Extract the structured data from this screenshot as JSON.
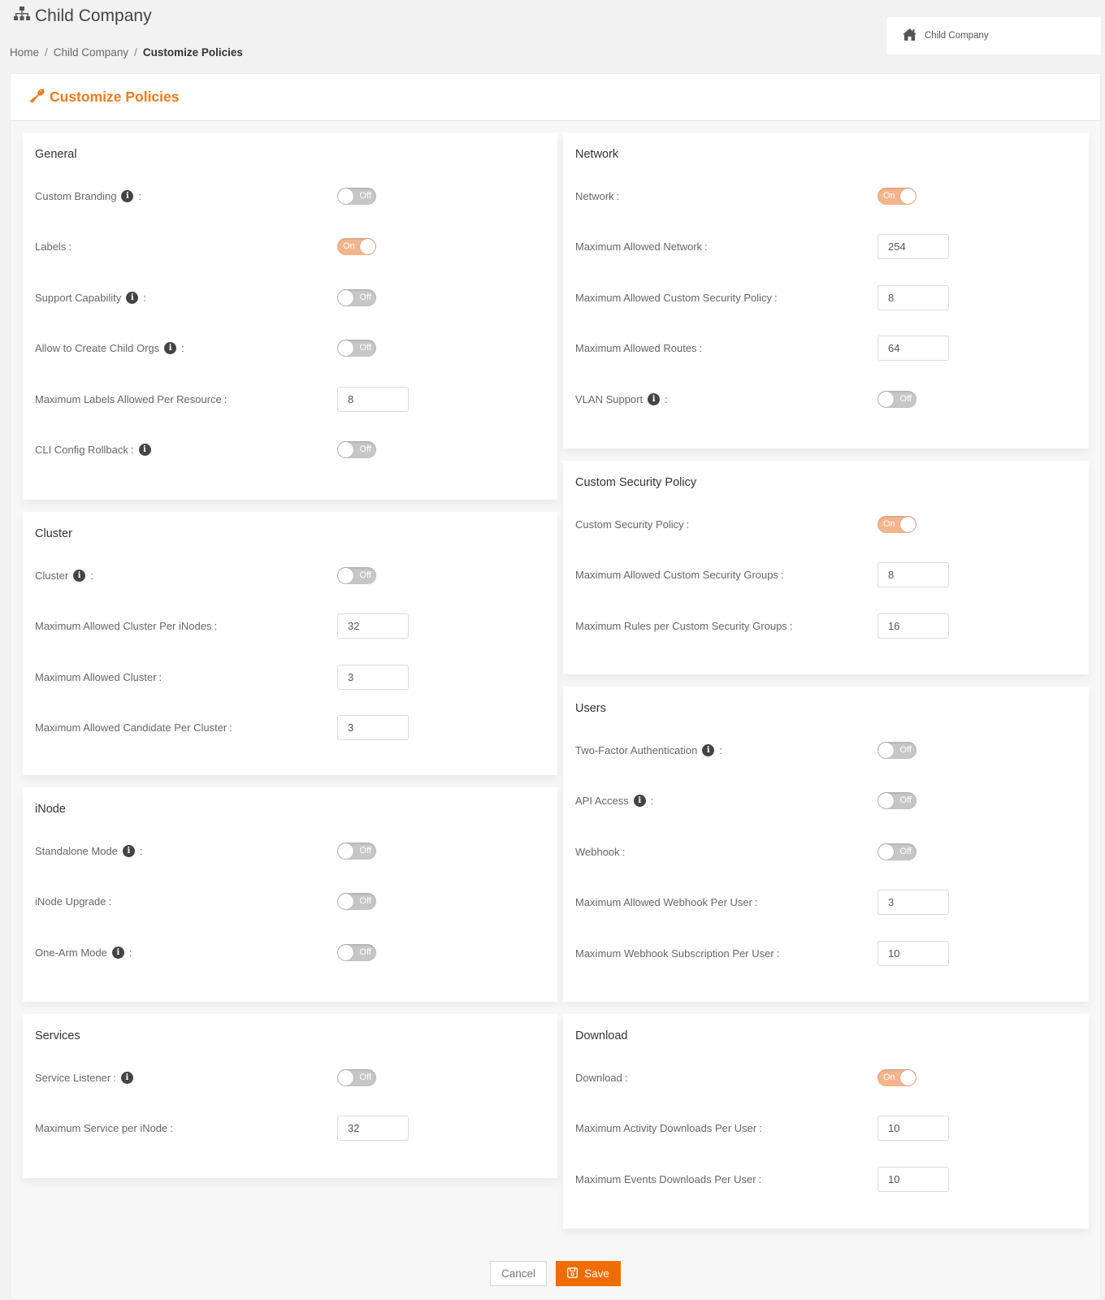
{
  "header": {
    "title": "Child Company",
    "title_icon": "sitemap-icon",
    "breadcrumb": [
      {
        "label": "Home",
        "current": false
      },
      {
        "label": "Child Company",
        "current": false
      },
      {
        "label": "Customize Policies",
        "current": true
      }
    ],
    "breadcrumb_separator": "/",
    "org_selector": {
      "icon": "home-icon",
      "label": "Child Company"
    }
  },
  "panel": {
    "title": "Customize Policies",
    "title_icon": "wrench-icon",
    "accent_color": "#f07a1e"
  },
  "toggle_labels": {
    "on": "On",
    "off": "Off"
  },
  "sections": {
    "general": {
      "title": "General",
      "rows": [
        {
          "label": "Custom Branding",
          "info": true,
          "info_before_colon": true,
          "type": "toggle",
          "value": false
        },
        {
          "label": "Labels",
          "info": false,
          "type": "toggle",
          "value": true
        },
        {
          "label": "Support Capability",
          "info": true,
          "info_before_colon": true,
          "type": "toggle",
          "value": false
        },
        {
          "label": "Allow to Create Child Orgs",
          "info": true,
          "info_before_colon": true,
          "type": "toggle",
          "value": false
        },
        {
          "label": "Maximum Labels Allowed Per Resource",
          "info": false,
          "type": "number",
          "value": "8"
        },
        {
          "label": "CLI Config Rollback",
          "info": true,
          "info_before_colon": false,
          "type": "toggle",
          "value": false
        }
      ]
    },
    "cluster": {
      "title": "Cluster",
      "rows": [
        {
          "label": "Cluster",
          "info": true,
          "info_before_colon": true,
          "type": "toggle",
          "value": false
        },
        {
          "label": "Maximum Allowed Cluster Per iNodes",
          "info": false,
          "type": "number",
          "value": "32"
        },
        {
          "label": "Maximum Allowed Cluster",
          "info": false,
          "type": "number",
          "value": "3"
        },
        {
          "label": "Maximum Allowed Candidate Per Cluster",
          "info": false,
          "type": "number",
          "value": "3"
        }
      ]
    },
    "inode": {
      "title": "iNode",
      "rows": [
        {
          "label": "Standalone Mode",
          "info": true,
          "info_before_colon": true,
          "type": "toggle",
          "value": false
        },
        {
          "label": "iNode Upgrade",
          "info": false,
          "type": "toggle",
          "value": false
        },
        {
          "label": "One-Arm Mode",
          "info": true,
          "info_before_colon": true,
          "type": "toggle",
          "value": false
        }
      ]
    },
    "services": {
      "title": "Services",
      "rows": [
        {
          "label": "Service Listener",
          "info": true,
          "info_before_colon": false,
          "type": "toggle",
          "value": false
        },
        {
          "label": "Maximum Service per iNode",
          "info": false,
          "type": "number",
          "value": "32"
        }
      ]
    },
    "network": {
      "title": "Network",
      "rows": [
        {
          "label": "Network",
          "info": false,
          "type": "toggle",
          "value": true
        },
        {
          "label": "Maximum Allowed Network",
          "info": false,
          "type": "number",
          "value": "254"
        },
        {
          "label": "Maximum Allowed Custom Security Policy",
          "info": false,
          "type": "number",
          "value": "8"
        },
        {
          "label": "Maximum Allowed Routes",
          "info": false,
          "type": "number",
          "value": "64"
        },
        {
          "label": "VLAN Support",
          "info": true,
          "info_before_colon": true,
          "type": "toggle",
          "value": false
        }
      ]
    },
    "custom_security_policy": {
      "title": "Custom Security Policy",
      "rows": [
        {
          "label": "Custom Security Policy",
          "info": false,
          "type": "toggle",
          "value": true
        },
        {
          "label": "Maximum Allowed Custom Security Groups",
          "info": false,
          "type": "number",
          "value": "8"
        },
        {
          "label": "Maximum Rules per Custom Security Groups",
          "info": false,
          "type": "number",
          "value": "16"
        }
      ]
    },
    "users": {
      "title": "Users",
      "rows": [
        {
          "label": "Two-Factor Authentication",
          "info": true,
          "info_before_colon": true,
          "type": "toggle",
          "value": false
        },
        {
          "label": "API Access",
          "info": true,
          "info_before_colon": true,
          "type": "toggle",
          "value": false
        },
        {
          "label": "Webhook",
          "info": false,
          "type": "toggle",
          "value": false
        },
        {
          "label": "Maximum Allowed Webhook Per User",
          "info": false,
          "type": "number",
          "value": "3"
        },
        {
          "label": "Maximum Webhook Subscription Per User",
          "info": false,
          "type": "number",
          "value": "10"
        }
      ]
    },
    "download": {
      "title": "Download",
      "rows": [
        {
          "label": "Download",
          "info": false,
          "type": "toggle",
          "value": true
        },
        {
          "label": "Maximum Activity Downloads Per User",
          "info": false,
          "type": "number",
          "value": "10"
        },
        {
          "label": "Maximum Events Downloads Per User",
          "info": false,
          "type": "number",
          "value": "10"
        }
      ]
    }
  },
  "footer": {
    "cancel_label": "Cancel",
    "save_label": "Save",
    "save_icon": "floppy-disk-icon",
    "save_color": "#ef6c00"
  }
}
